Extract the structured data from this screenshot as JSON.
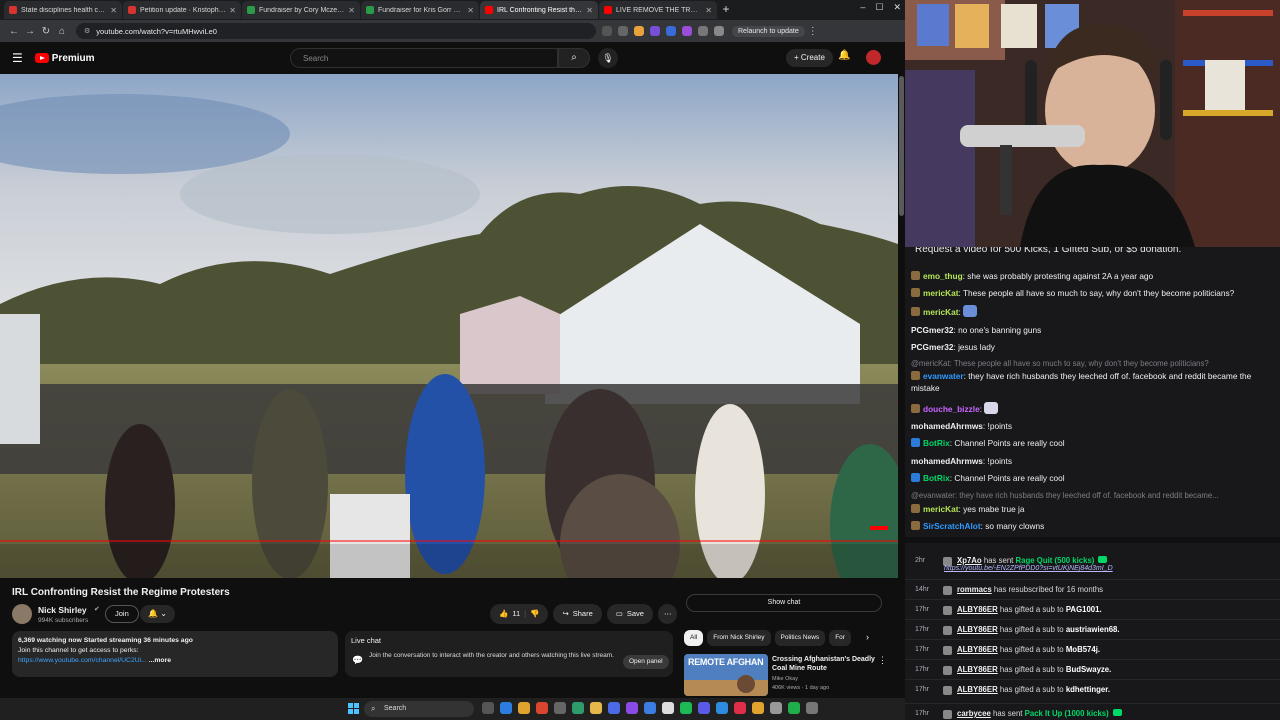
{
  "browser": {
    "tabs": [
      {
        "title": "State disciplines health care p",
        "color": "#d8342f"
      },
      {
        "title": "Petition update · Kristopher's s",
        "color": "#d8342f"
      },
      {
        "title": "Fundraiser by Cory Mczenna :",
        "color": "#2c9b47"
      },
      {
        "title": "Fundraiser for Kris Gorr by Kelli",
        "color": "#2c9b47"
      },
      {
        "title": "IRL Confronting Resist the R",
        "color": "#ff0000",
        "active": true
      },
      {
        "title": "LIVE REMOVE THE TRUMP REG",
        "color": "#ff0000"
      }
    ],
    "url": "youtube.com/watch?v=rtuMHwviLe0",
    "relaunch_label": "Relaunch to update"
  },
  "youtube": {
    "logo_text": "Premium",
    "search_placeholder": "Search",
    "create_label": "Create",
    "video_title": "IRL Confronting Resist the Regime Protesters",
    "channel_name": "Nick Shirley",
    "channel_subs": "994K subscribers",
    "join_label": "Join",
    "like_count": "11",
    "share_label": "Share",
    "save_label": "Save",
    "description": {
      "stats": "6,369 watching now  Started streaming 36 minutes ago",
      "line2": "Join this channel to get access to perks:",
      "link": "https://www.youtube.com/channel/UC2Ui...",
      "more": "...more"
    },
    "livechat": {
      "heading": "Live chat",
      "text": "Join the conversation to interact with the creator and others watching this live stream.",
      "open_label": "Open panel"
    },
    "show_chat_label": "Show chat",
    "chips": [
      "All",
      "From Nick Shirley",
      "Politics News",
      "For"
    ],
    "recommended": {
      "thumb_label": "REMOTE AFGHAN",
      "title": "Crossing Afghanistan's Deadly Coal Mine Route",
      "channel": "Mike Okay",
      "meta": "406K views · 1 day ago"
    }
  },
  "taskbar": {
    "search_label": "Search"
  },
  "chat": {
    "pinned": "Request a video for 500 Kicks, 1 Gifted Sub, or $5 donation.",
    "messages": [
      {
        "user": "emo_thug",
        "color": "#b5e655",
        "text": "she was probably protesting against 2A a year ago",
        "badge": "#8a6a3f"
      },
      {
        "user": "mericKat",
        "color": "#b5e655",
        "text": "These people all have so much to say, why don't they become politicians?",
        "badge": "#8a6a3f"
      },
      {
        "user": "mericKat",
        "color": "#b5e655",
        "text": "",
        "badge": "#8a6a3f",
        "emote": "#6a8fd8"
      },
      {
        "user": "PCGmer32",
        "color": "#efeff1",
        "text": "no one's banning guns"
      },
      {
        "user": "PCGmer32",
        "color": "#efeff1",
        "text": "jesus lady"
      },
      {
        "user": "",
        "color": "#7d7d85",
        "text": "@mericKat: These people all have so much to say, why don't they become politicians?",
        "reply": true
      },
      {
        "user": "evanwater",
        "color": "#2e9bff",
        "text": "they have rich husbands they leeched off of. facebook and reddit became the mistake",
        "badge": "#8a6a3f"
      },
      {
        "user": "douche_bizzle",
        "color": "#c865ff",
        "text": "",
        "badge": "#8a6a3f",
        "emote": "#d8d8e8"
      },
      {
        "user": "mohamedAhrmws",
        "color": "#efeff1",
        "text": "!points"
      },
      {
        "user": "BotRix",
        "color": "#00d966",
        "text": "Channel Points are really cool",
        "badge": "#2b7bd9"
      },
      {
        "user": "mohamedAhrmws",
        "color": "#efeff1",
        "text": "!points"
      },
      {
        "user": "BotRix",
        "color": "#00d966",
        "text": "Channel Points are really cool",
        "badge": "#2b7bd9"
      },
      {
        "user": "",
        "color": "#7d7d85",
        "text": "@evanwater: they have rich husbands they leeched off of. facebook and reddit became...",
        "reply": true
      },
      {
        "user": "mericKat",
        "color": "#b5e655",
        "text": "yes mabe true ja",
        "badge": "#8a6a3f"
      },
      {
        "user": "SirScratchAlot",
        "color": "#2e9bff",
        "text": "so many clowns",
        "badge": "#8a6a3f"
      }
    ]
  },
  "feed": {
    "events": [
      {
        "time": "2hr",
        "user": "Xp7Ao",
        "pre": "has sent",
        "highlight": "Rage Quit (500 kicks)",
        "hcolor": "green"
      },
      {
        "time": "14hr",
        "user": "rommacs",
        "pre": "has resubscribed for 16 months",
        "highlight": "",
        "hcolor": ""
      },
      {
        "time": "17hr",
        "user": "ALBY86ER",
        "pre": "has gifted a sub to",
        "highlight": "PAG1001.",
        "hcolor": "white"
      },
      {
        "time": "17hr",
        "user": "ALBY86ER",
        "pre": "has gifted a sub to",
        "highlight": "austriawien68.",
        "hcolor": "white"
      },
      {
        "time": "17hr",
        "user": "ALBY86ER",
        "pre": "has gifted a sub to",
        "highlight": "MoB574j.",
        "hcolor": "white"
      },
      {
        "time": "17hr",
        "user": "ALBY86ER",
        "pre": "has gifted a sub to",
        "highlight": "BudSwayze.",
        "hcolor": "white"
      },
      {
        "time": "17hr",
        "user": "ALBY86ER",
        "pre": "has gifted a sub to",
        "highlight": "kdhettinger.",
        "hcolor": "white"
      },
      {
        "time": "17hr",
        "user": "carbycee",
        "pre": "has sent",
        "highlight": "Pack It Up (1000 kicks)",
        "hcolor": "green"
      }
    ],
    "link": "https://youtu.be/-EN2ZPfPDD0?si=vtUKjNEj84d3mI_D"
  }
}
